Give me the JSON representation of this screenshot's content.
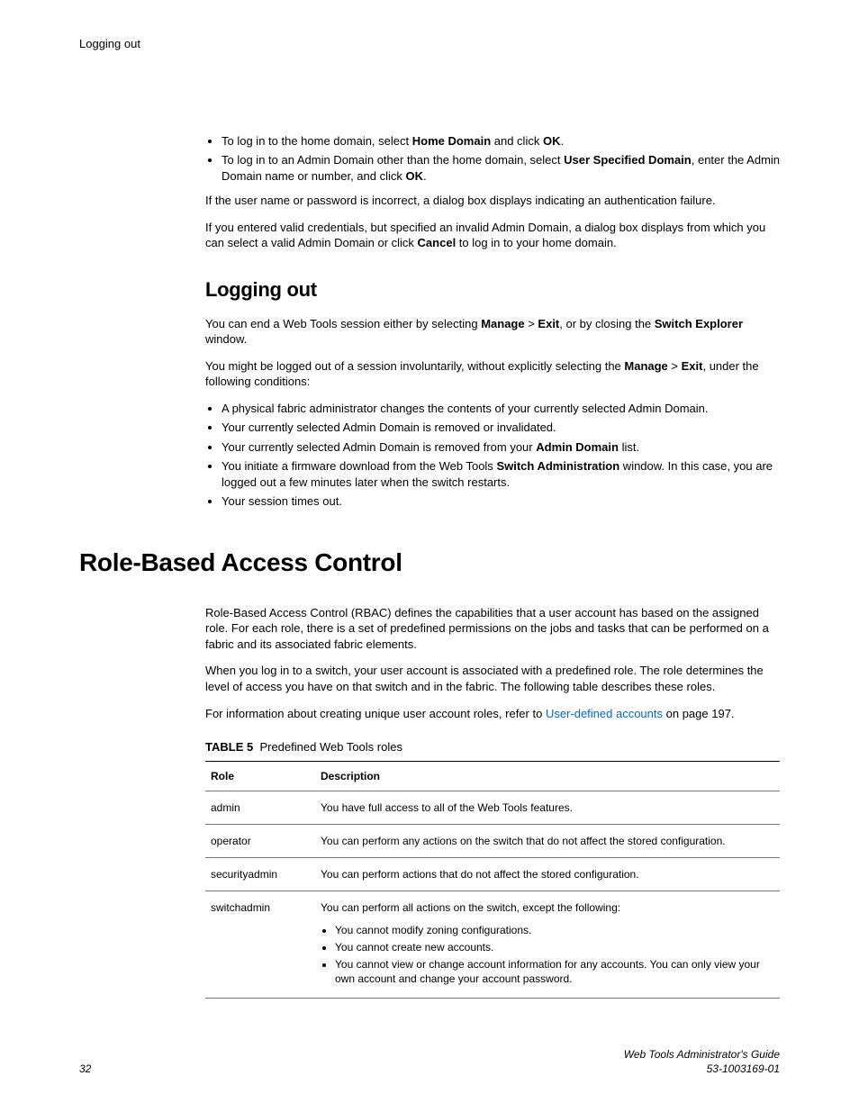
{
  "running_head": "Logging out",
  "intro": {
    "bullets": [
      {
        "prefix": "To log in to the home domain, select ",
        "b1": "Home Domain",
        "mid1": " and click ",
        "b2": "OK",
        "suffix": "."
      },
      {
        "prefix": "To log in to an Admin Domain other than the home domain, select ",
        "b1": "User Specified Domain",
        "mid1": ", enter the Admin Domain name or number, and click ",
        "b2": "OK",
        "suffix": "."
      }
    ],
    "p1": "If the user name or password is incorrect, a dialog box displays indicating an authentication failure.",
    "p2_a": "If you entered valid credentials, but specified an invalid Admin Domain, a dialog box displays from which you can select a valid Admin Domain or click ",
    "p2_b": "Cancel",
    "p2_c": " to log in to your home domain."
  },
  "logout": {
    "heading": "Logging out",
    "p1_a": "You can end a Web Tools session either by selecting ",
    "p1_b": "Manage",
    "p1_c": "  > ",
    "p1_d": "Exit",
    "p1_e": ", or by closing the ",
    "p1_f": "Switch Explorer",
    "p1_g": " window.",
    "p2_a": "You might be logged out of a session involuntarily, without explicitly selecting the ",
    "p2_b": "Manage",
    "p2_c": "  > ",
    "p2_d": "Exit",
    "p2_e": ", under the following conditions:",
    "bullets": [
      {
        "text": "A physical fabric administrator changes the contents of your currently selected Admin Domain."
      },
      {
        "text": "Your currently selected Admin Domain is removed or invalidated."
      },
      {
        "prefix": "Your currently selected Admin Domain is removed from your ",
        "b1": "Admin Domain",
        "suffix": " list."
      },
      {
        "prefix": "You initiate a firmware download from the Web Tools ",
        "b1": "Switch Administration",
        "suffix": " window. In this case, you are logged out a few minutes later when the switch restarts."
      },
      {
        "text": "Your session times out."
      }
    ]
  },
  "rbac": {
    "heading": "Role-Based Access Control",
    "p1": "Role-Based Access Control (RBAC) defines the capabilities that a user account has based on the assigned role. For each role, there is a set of predefined permissions on the jobs and tasks that can be performed on a fabric and its associated fabric elements.",
    "p2": "When you log in to a switch, your user account is associated with a predefined role. The role determines the level of access you have on that switch and in the fabric. The following table describes these roles.",
    "p3_a": "For information about creating unique user account roles, refer to ",
    "p3_link": "User-defined accounts",
    "p3_b": " on page 197.",
    "table_label": "TABLE 5",
    "table_caption": "Predefined Web Tools roles",
    "th_role": "Role",
    "th_desc": "Description",
    "rows": [
      {
        "role": "admin",
        "desc": "You have full access to all of the Web Tools features."
      },
      {
        "role": "operator",
        "desc": "You can perform any actions on the switch that do not affect the stored configuration."
      },
      {
        "role": "securityadmin",
        "desc": "You can perform actions that do not affect the stored configuration."
      },
      {
        "role": "switchadmin",
        "desc": "You can perform all actions on the switch, except the following:",
        "sub": [
          "You cannot modify zoning configurations.",
          "You cannot create new accounts.",
          "You cannot view or change account information for any accounts. You can only view your own account and change your account password."
        ]
      }
    ]
  },
  "footer": {
    "page": "32",
    "title": "Web Tools Administrator's Guide",
    "docnum": "53-1003169-01"
  }
}
